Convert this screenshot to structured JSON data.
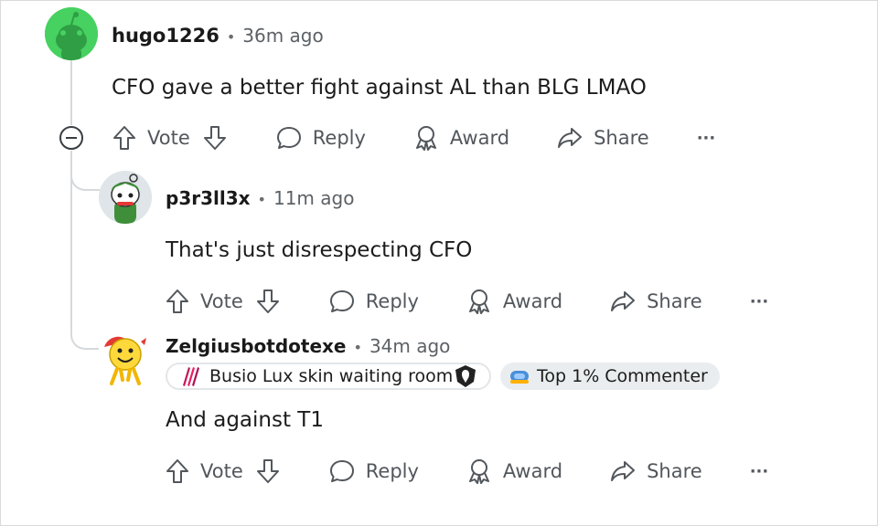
{
  "comments": [
    {
      "username": "hugo1226",
      "time": "36m ago",
      "text": "CFO gave a better fight against AL than BLG LMAO",
      "actions": {
        "vote": "Vote",
        "reply": "Reply",
        "award": "Award",
        "share": "Share",
        "more": "···"
      }
    },
    {
      "username": "p3r3ll3x",
      "time": "11m ago",
      "text": "That's just disrespecting CFO",
      "actions": {
        "vote": "Vote",
        "reply": "Reply",
        "award": "Award",
        "share": "Share",
        "more": "···"
      }
    },
    {
      "username": "Zelgiusbotdotexe",
      "time": "34m ago",
      "flairs": [
        "Busio Lux skin waiting room",
        "Top 1% Commenter"
      ],
      "text": "And against T1",
      "actions": {
        "vote": "Vote",
        "reply": "Reply",
        "award": "Award",
        "share": "Share",
        "more": "···"
      }
    }
  ],
  "colors": {
    "avatar_green": "#46d160",
    "thread_line": "#d6d9dc",
    "muted_text": "#52575c",
    "flair_bg": "#eaedef"
  },
  "icons": {
    "upvote": "arrow-up-outline-icon",
    "downvote": "arrow-down-outline-icon",
    "reply": "speech-bubble-icon",
    "award": "award-ribbon-icon",
    "share": "share-arrow-icon",
    "collapse": "minus-circle-icon"
  }
}
